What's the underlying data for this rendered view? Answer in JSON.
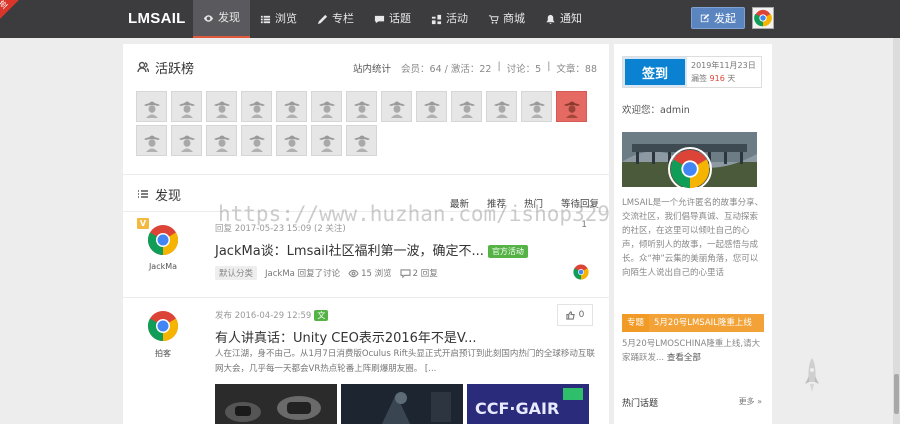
{
  "header": {
    "ribbon": "签",
    "logo": "LMSAIL",
    "nav": [
      {
        "label": "发现",
        "icon": "eye-icon",
        "active": true
      },
      {
        "label": "浏览",
        "icon": "list-icon"
      },
      {
        "label": "专栏",
        "icon": "pen-icon"
      },
      {
        "label": "话题",
        "icon": "chat-icon"
      },
      {
        "label": "活动",
        "icon": "activity-icon"
      },
      {
        "label": "商城",
        "icon": "cart-icon"
      },
      {
        "label": "通知",
        "icon": "bell-icon"
      }
    ],
    "post_button": "发起"
  },
  "active_section": {
    "title": "活跃榜",
    "stats_label": "站内统计",
    "stats": [
      "会员：64 / 激活：22",
      "讨论：5",
      "文章：88"
    ]
  },
  "discover": {
    "title": "发现",
    "tabs": [
      "最新",
      "推荐",
      "热门",
      "等待回复"
    ]
  },
  "posts": [
    {
      "badge": "V",
      "user": "JackMa",
      "meta": "回复 2017-05-23 15:09 (2 关注)",
      "title": "JackMa谈：Lmsail社区福利第一波，确定不...",
      "tag": "官方活动",
      "category": "默认分类",
      "foot_user": "JackMa 回复了讨论",
      "views": "15 浏览",
      "replies": "2 回复",
      "corner": "1"
    },
    {
      "user": "拍客",
      "meta": "发布 2016-04-29 12:59",
      "meta_tag": "文",
      "title": "有人讲真话：Unity CEO表示2016年不是V...",
      "excerpt": "人在江湖，身不由己。从1月7日消费版Oculus Rift头显正式开启预订到此刻国内热门的全球移动互联网大会，几乎每一天都会VR热点轮番上阵刷爆朋友圈。 [...",
      "likes": "0"
    }
  ],
  "sidebar": {
    "signin_label": "签到",
    "signin_date": "2019年11月23日",
    "signin_streak_prefix": "漏签",
    "signin_streak_value": "916",
    "signin_streak_suffix": "天",
    "welcome": "欢迎您：admin",
    "intro": "LMSAIL是一个允许匿名的故事分享、交流社区，我们倡导真诚、互动探索的社区，在这里可以倾吐自己的心声，倾听别人的故事，一起感悟与成长。众“神”云集的美丽角落，您可以向陌生人说出自己的心里话",
    "notice_tag": "专题",
    "notice_title": "5月20号LMSAIL隆重上线",
    "notice_text": "5月20号LMOSCHINA隆重上线,请大家踊跃发...",
    "notice_link": "查看全部",
    "hot_title": "热门话题",
    "hot_more": "更多 »"
  },
  "watermark": "https://www.huzhan.com/ishop32941"
}
